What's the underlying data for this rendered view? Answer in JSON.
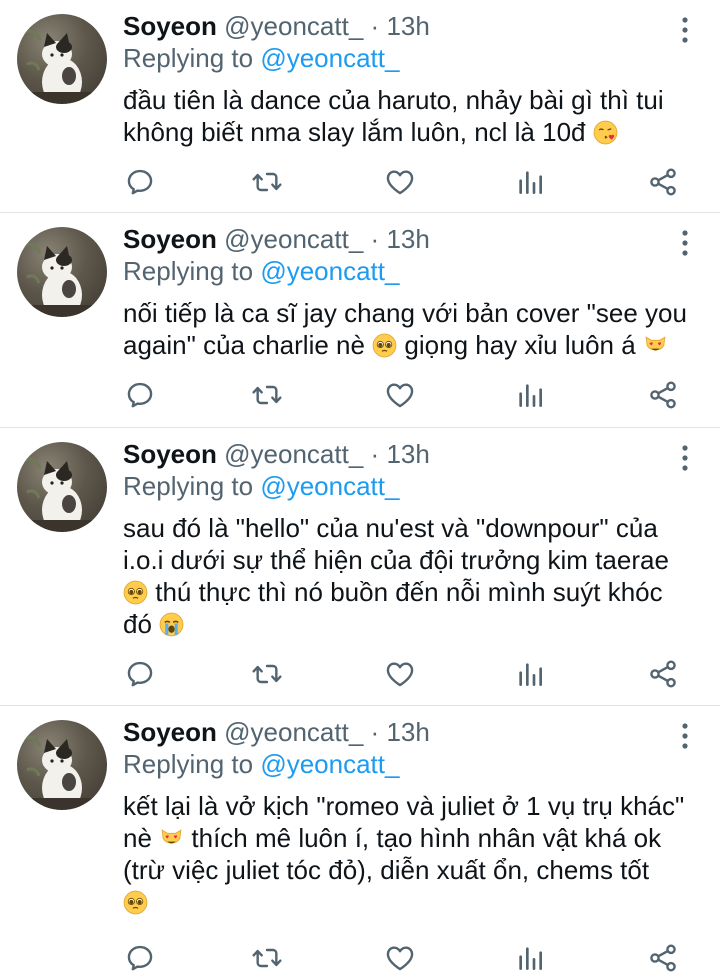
{
  "tweets": [
    {
      "name": "Soyeon",
      "handle": "@yeoncatt_",
      "dot": "·",
      "time": "13h",
      "replying_label": "Replying to",
      "replying_to": "@yeoncatt_",
      "lines": [
        "đầu tiên là dance của haruto, nhảy bài gì thì tui",
        "không biết nma slay lắm luôn, ncl là 10đ"
      ],
      "emojis": [
        "face-blowing-kiss"
      ]
    },
    {
      "name": "Soyeon",
      "handle": "@yeoncatt_",
      "dot": "·",
      "time": "13h",
      "replying_label": "Replying to",
      "replying_to": "@yeoncatt_",
      "lines": [
        "nối tiếp là ca sĩ jay chang với bản cover \"see you",
        "again\" của charlie nè",
        "giọng hay xỉu luôn á"
      ],
      "emojis": [
        "pleading-face",
        "heart-eyes-cat"
      ]
    },
    {
      "name": "Soyeon",
      "handle": "@yeoncatt_",
      "dot": "·",
      "time": "13h",
      "replying_label": "Replying to",
      "replying_to": "@yeoncatt_",
      "lines": [
        "sau đó là \"hello\" của nu'est và \"downpour\" của",
        "i.o.i dưới sự thể hiện của đội trưởng kim taerae",
        "thú thực thì nó buồn đến nỗi mình suýt khóc",
        "đó"
      ],
      "emojis": [
        "pleading-face",
        "loudly-crying-face"
      ]
    },
    {
      "name": "Soyeon",
      "handle": "@yeoncatt_",
      "dot": "·",
      "time": "13h",
      "replying_label": "Replying to",
      "replying_to": "@yeoncatt_",
      "lines": [
        "kết lại là vở kịch \"romeo và juliet ở 1 vụ trụ khác\"",
        "nè",
        "thích mê luôn í, tạo hình nhân vật khá ok",
        "(trừ việc juliet tóc đỏ), diễn xuất ổn, chems tốt"
      ],
      "emojis": [
        "heart-eyes-cat",
        "pleading-face"
      ]
    }
  ],
  "action_icons": [
    "reply-icon",
    "retweet-icon",
    "like-icon",
    "analytics-icon",
    "share-icon"
  ],
  "colors": {
    "link": "#1d9bf0",
    "secondary": "#536471",
    "divider": "#dfe3e6"
  }
}
